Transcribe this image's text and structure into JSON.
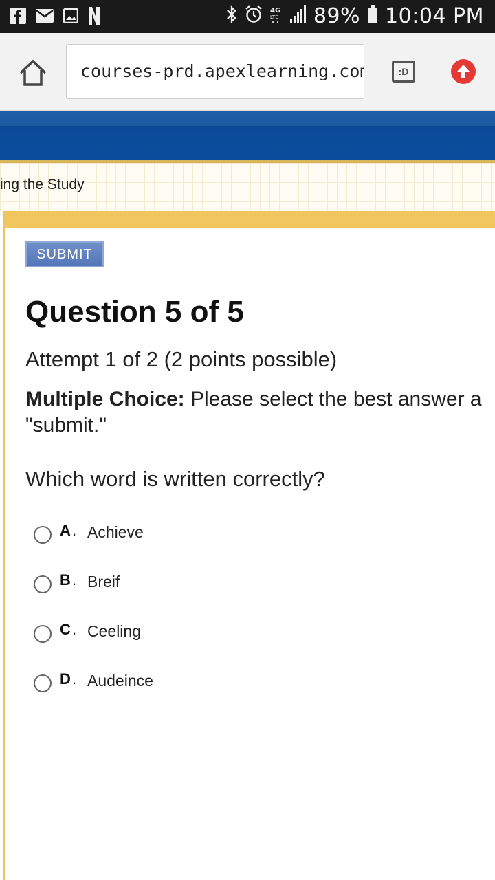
{
  "status_bar": {
    "battery": "89%",
    "time": "10:04 PM",
    "network": "4G"
  },
  "browser": {
    "url": "courses-prd.apexlearning.com/",
    "tab_icon_label": ":D"
  },
  "breadcrumb": {
    "text": "ing the Study"
  },
  "quiz": {
    "submit_label": "SUBMIT",
    "title": "Question 5 of 5",
    "attempt": "Attempt 1 of 2 (2 points possible)",
    "instruction_label": "Multiple Choice:",
    "instruction_text": " Please select the best answer a",
    "instruction_text_2": "\"submit.\"",
    "prompt": "Which word is written correctly?",
    "options": [
      {
        "letter": "A",
        "text": "Achieve"
      },
      {
        "letter": "B",
        "text": "Breif"
      },
      {
        "letter": "C",
        "text": "Ceeling"
      },
      {
        "letter": "D",
        "text": "Audeince"
      }
    ]
  },
  "colors": {
    "header_blue": "#0b4d9c",
    "panel_gold": "#f2c65e",
    "submit_blue": "#5576b9",
    "upload_red": "#e53935"
  }
}
